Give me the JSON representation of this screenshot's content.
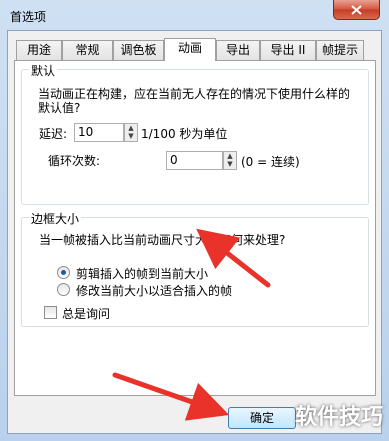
{
  "window": {
    "title": "首选项"
  },
  "tabs": [
    "用途",
    "常规",
    "调色板",
    "动画",
    "导出",
    "导出 II",
    "帧提示"
  ],
  "active_tab": "动画",
  "default_group": {
    "legend": "默认",
    "description": "当动画正在构建，应在当前无人存在的情况下使用什么样的默认值?",
    "delay_label": "延迟:",
    "delay_value": "10",
    "delay_unit": "1/100 秒为单位",
    "loop_label": "循环次数:",
    "loop_value": "0",
    "loop_hint": "(0 = 连续)"
  },
  "border_group": {
    "legend": "边框大小",
    "question": "当一帧被插入比当前动画尺寸大，如何来处理?",
    "option_crop": "剪辑插入的帧到当前大小",
    "option_resize": "修改当前大小以适合插入的帧",
    "always_ask": "总是询问"
  },
  "buttons": {
    "ok": "确定"
  },
  "watermark": "软件技巧",
  "colors": {
    "arrow": "#e8322a",
    "accent": "#1d5aa8"
  }
}
